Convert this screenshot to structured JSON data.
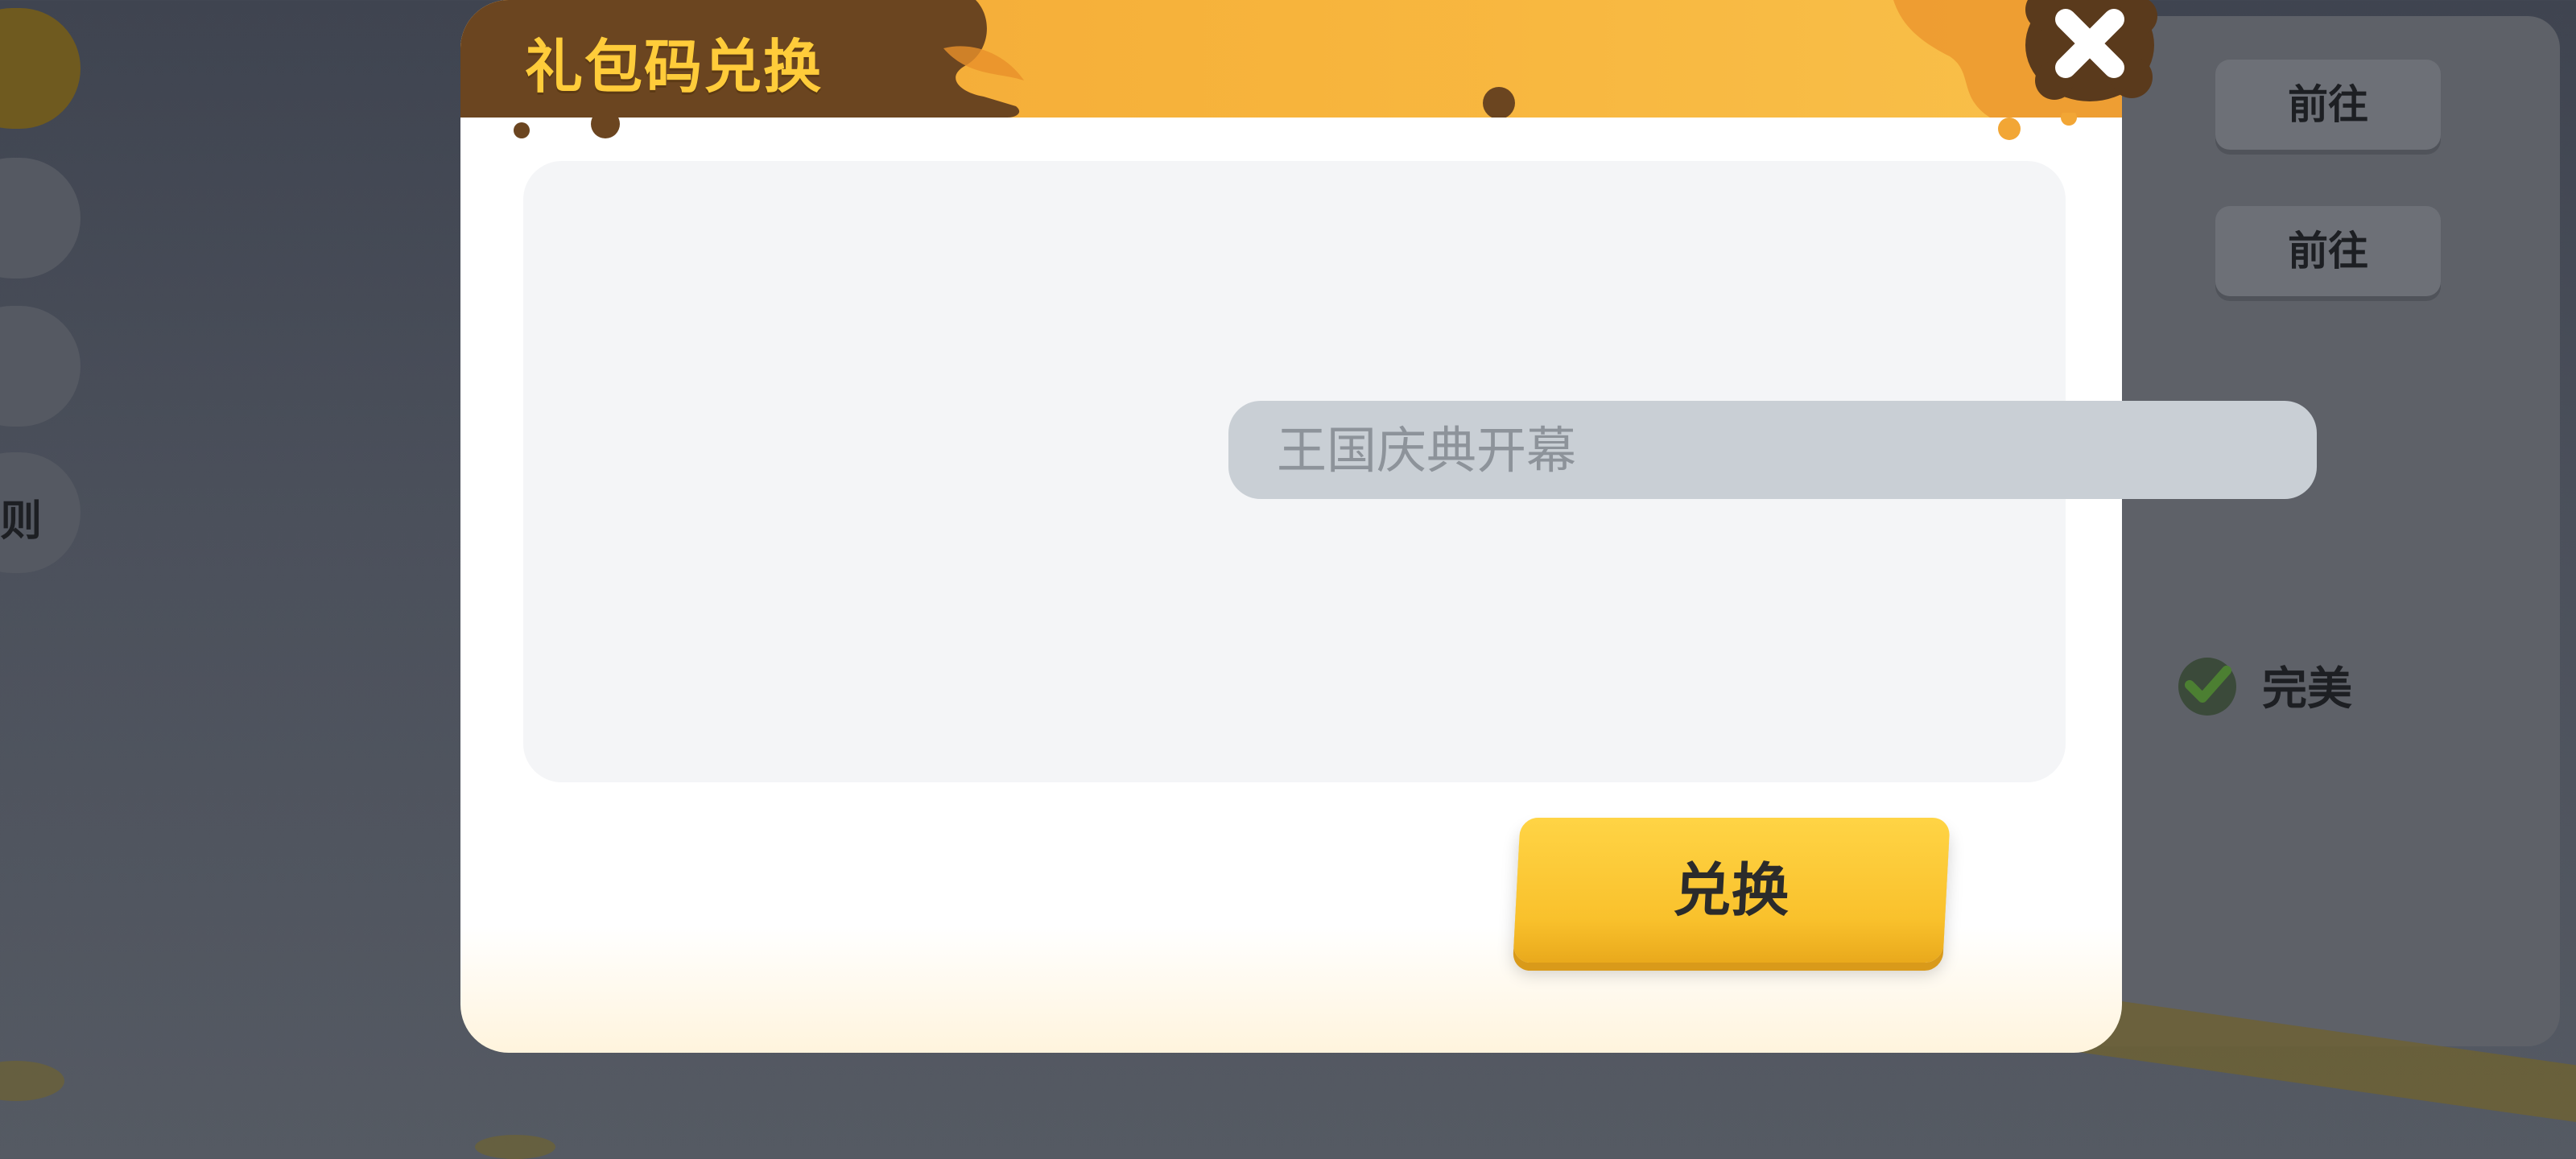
{
  "modal": {
    "title": "礼包码兑换",
    "input_placeholder": "王国庆典开幕",
    "redeem_label": "兑换"
  },
  "background": {
    "go_buttons": [
      "前往",
      "前往"
    ],
    "perfect_label": "完美",
    "left_tab_fragment": "则"
  },
  "colors": {
    "header_orange": "#f7b43c",
    "button_yellow": "#ffd445",
    "title_text": "#ffcc3a",
    "drip_brown": "#6b4520"
  },
  "icons": {
    "close": "close-x-icon",
    "perfect": "check-badge-icon"
  }
}
